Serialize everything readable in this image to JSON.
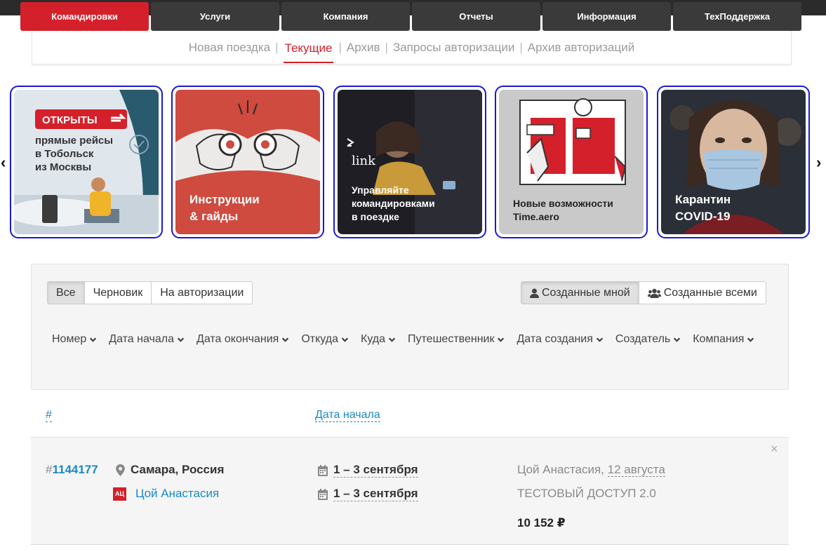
{
  "top_nav": {
    "tabs": [
      "Командировки",
      "Услуги",
      "Компания",
      "Отчеты",
      "Информация",
      "ТехПоддержка"
    ],
    "active_index": 0
  },
  "sub_nav": {
    "items": [
      "Новая поездка",
      "Текущие",
      "Архив",
      "Запросы авторизации",
      "Архив авторизаций"
    ],
    "active_index": 1,
    "separator": "|"
  },
  "carousel": {
    "prev": "‹",
    "next": "›",
    "banners": [
      {
        "badge": "ОТКРЫТЫ",
        "lines": [
          "прямые рейсы",
          "в Тобольск",
          "из Москвы"
        ]
      },
      {
        "lines": [
          "Инструкции",
          "& гайды"
        ]
      },
      {
        "logo": "link",
        "lines": [
          "Управляйте",
          "командировками",
          "в поездке"
        ]
      },
      {
        "lines": [
          "Новые возможности",
          "Time.aero"
        ]
      },
      {
        "lines": [
          "Карантин",
          "COVID-19"
        ]
      }
    ]
  },
  "filters": {
    "status_buttons": [
      "Все",
      "Черновик",
      "На авторизации"
    ],
    "status_active": 0,
    "owner_buttons": [
      "Созданные мной",
      "Созданные всеми"
    ],
    "owner_active": 0,
    "sort_fields": [
      "Номер",
      "Дата начала",
      "Дата окончания",
      "Откуда",
      "Куда",
      "Путешественник",
      "Дата создания",
      "Создатель",
      "Компания"
    ]
  },
  "table": {
    "col_number": "#",
    "col_start": "Дата начала"
  },
  "trips": [
    {
      "hash": "#",
      "number": "1144177",
      "city": "Самара, Россия",
      "traveler_initials": "АЦ",
      "traveler": "Цой Анастасия",
      "date1": "1 – 3 сентября",
      "date2": "1 – 3 сентября",
      "creator": "Цой Анастасия, ",
      "created": "12 августа",
      "company": "ТЕСТОВЫЙ ДОСТУП 2.0",
      "price": "10 152 ₽",
      "close": "×"
    }
  ],
  "colors": {
    "accent": "#d4202a",
    "link": "#1a8ac4",
    "banner_border": "#1a1ad8"
  }
}
